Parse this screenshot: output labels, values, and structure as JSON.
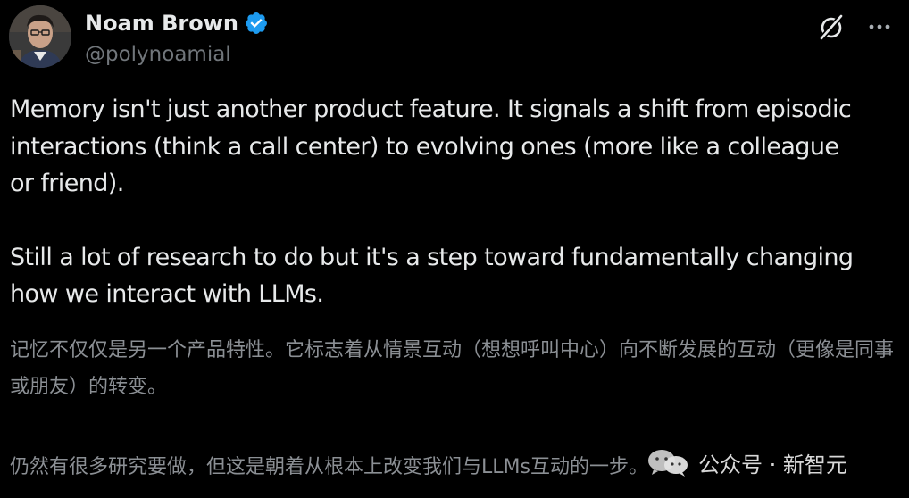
{
  "author": {
    "display_name": "Noam Brown",
    "handle": "@polynoamial",
    "avatar_icon": "avatar-photo",
    "verified_icon": "verified-badge-icon"
  },
  "actions": {
    "grok_icon": "grok-icon",
    "more_icon": "more-icon"
  },
  "tweet": {
    "paragraph_1": "Memory isn't just another product feature. It signals a shift from episodic\ninteractions (think a call center) to evolving ones (more like a colleague\nor friend).",
    "paragraph_2": "Still a lot of research to do but it's a step toward fundamentally changing\nhow we interact with LLMs."
  },
  "translation": {
    "paragraph_1": "记忆不仅仅是另一个产品特性。它标志着从情景互动（想想呼叫中心）向不断发展的互动（更像是同事或朋友）的转变。",
    "paragraph_2": "仍然有很多研究要做，但这是朝着从根本上改变我们与LLMs互动的一步。"
  },
  "watermark": {
    "text": "公众号 · 新智元"
  },
  "colors": {
    "background": "#000000",
    "primary_text": "#e7e9ea",
    "secondary_text": "#71767b",
    "verified_blue": "#1d9bf0",
    "translation_text": "#8b8f94"
  }
}
